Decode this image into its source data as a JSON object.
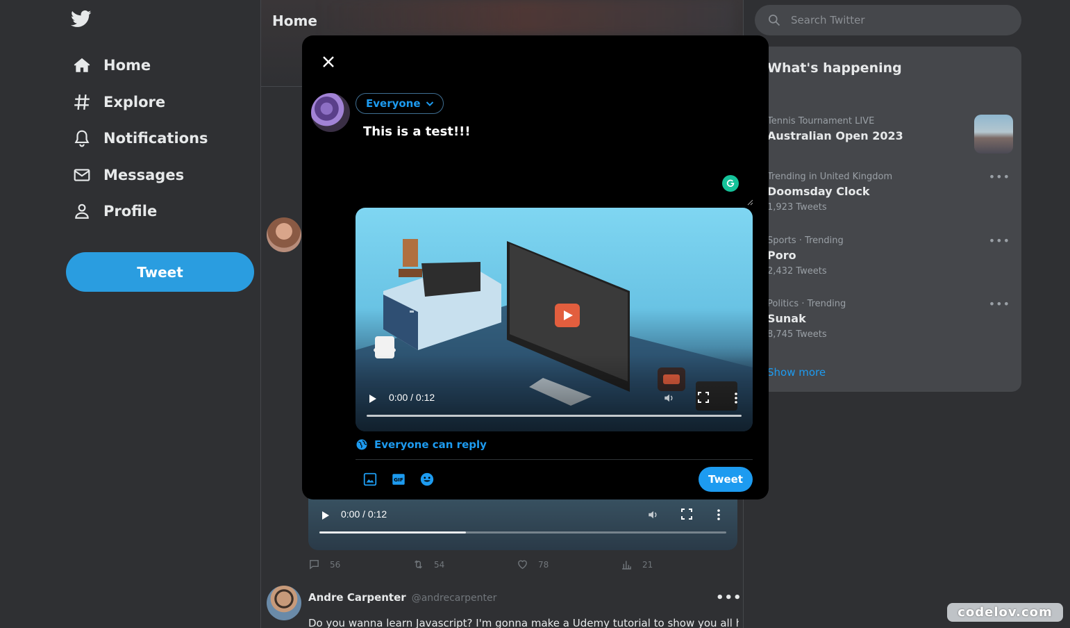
{
  "sidebar": {
    "logo": "twitter-bird-icon",
    "items": [
      {
        "label": "Home",
        "icon": "home-icon"
      },
      {
        "label": "Explore",
        "icon": "hashtag-icon"
      },
      {
        "label": "Notifications",
        "icon": "bell-icon"
      },
      {
        "label": "Messages",
        "icon": "mail-icon"
      },
      {
        "label": "Profile",
        "icon": "user-icon"
      }
    ],
    "tweet_button": "Tweet"
  },
  "feed": {
    "title": "Home",
    "post1": {
      "video_time": "0:00 / 0:12",
      "video_progress": 0.36,
      "stats": {
        "replies": "56",
        "retweets": "54",
        "likes": "78",
        "views": "21"
      }
    },
    "post2": {
      "name": "Andre Carpenter",
      "handle": "@andrecarpenter",
      "more": "•••",
      "text": "Do you wanna learn Javascript? I'm gonna make a Udemy tutorial to show you all how"
    }
  },
  "search": {
    "placeholder": "Search Twitter"
  },
  "trends": {
    "title": "What's happening",
    "items": [
      {
        "category": "Tennis Tournament LIVE",
        "name": "Australian Open 2023",
        "count": ""
      },
      {
        "category": "Trending in United Kingdom",
        "name": "Doomsday Clock",
        "count": "1,923 Tweets"
      },
      {
        "category": "Sports · Trending",
        "name": "Poro",
        "count": "2,432 Tweets"
      },
      {
        "category": "Politics · Trending",
        "name": "Sunak",
        "count": "8,745 Tweets"
      }
    ],
    "show_more": "Show more"
  },
  "compose": {
    "audience": "Everyone",
    "text": "This is a test!!!",
    "video_time": "0:00 / 0:12",
    "reply_setting": "Everyone can reply",
    "tweet_button": "Tweet"
  },
  "watermark": "codelov.com",
  "colors": {
    "accent": "#1d9bf0",
    "sidebar_tweet": "#2a9de0",
    "background": "#2f3033",
    "panel": "#45474b",
    "modal": "#000000"
  }
}
